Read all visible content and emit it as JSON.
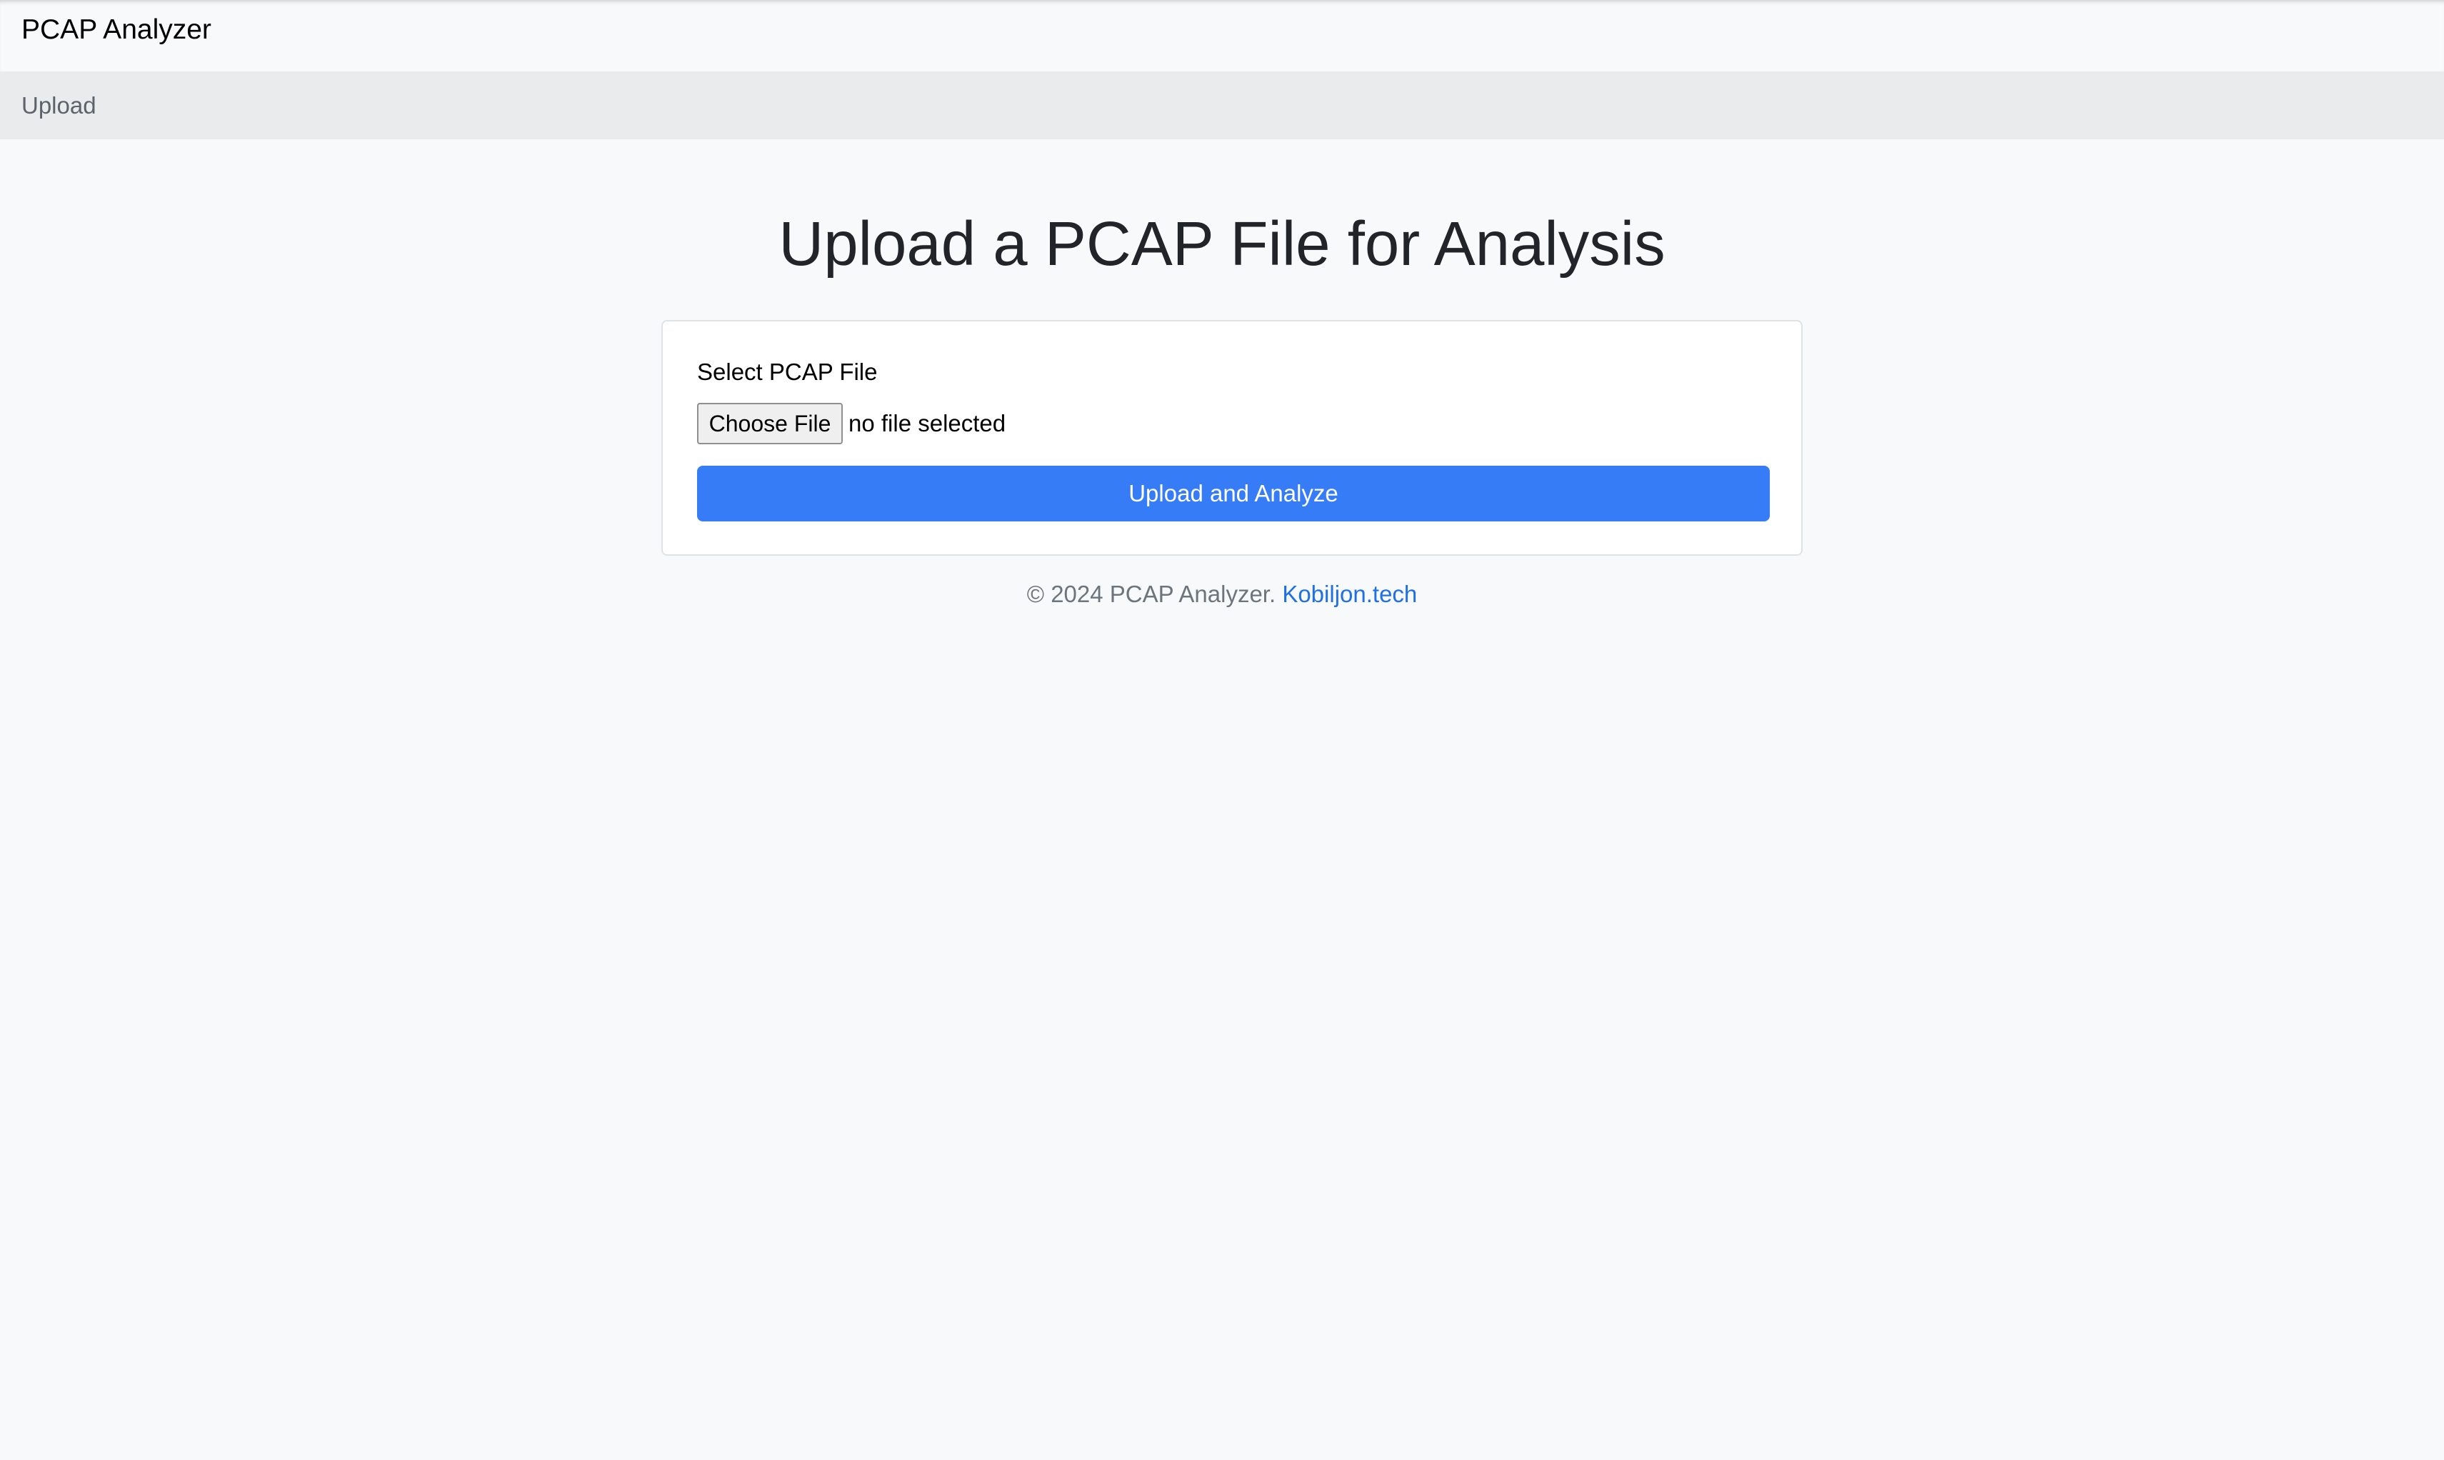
{
  "app": {
    "brand": "PCAP Analyzer"
  },
  "subnav": {
    "upload_label": "Upload"
  },
  "main": {
    "title": "Upload a PCAP File for Analysis"
  },
  "form": {
    "file_label": "Select PCAP File",
    "choose_button_label": "Choose File",
    "file_status": "no file selected",
    "submit_label": "Upload and Analyze"
  },
  "footer": {
    "copyright": "© 2024 PCAP Analyzer.",
    "link_text": "Kobiljon.tech"
  },
  "colors": {
    "primary": "#367cf6",
    "link": "#1f6fe5",
    "page_background": "#f8f9fa",
    "subnav_background": "#eaebed",
    "muted_text": "#6c757d"
  }
}
